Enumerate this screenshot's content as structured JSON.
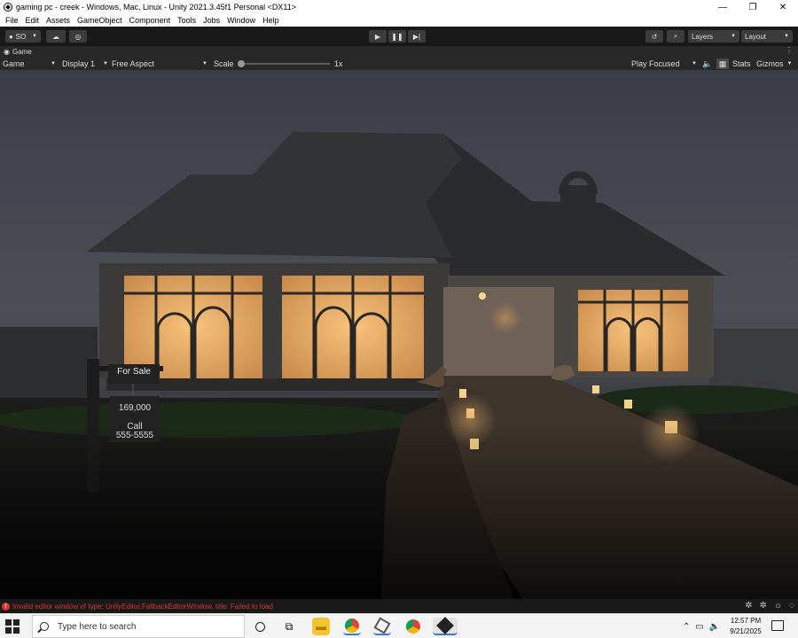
{
  "window": {
    "title": "gaming pc - creek - Windows, Mac, Linux - Unity 2021.3.45f1 Personal <DX11>",
    "minimize": "—",
    "restore": "❐",
    "close": "✕"
  },
  "menu": [
    "File",
    "Edit",
    "Assets",
    "GameObject",
    "Component",
    "Tools",
    "Jobs",
    "Window",
    "Help"
  ],
  "toolbar": {
    "account": "SO",
    "layers": "Layers",
    "layout": "Layout"
  },
  "tab": {
    "label": "Game"
  },
  "gamebar": {
    "mode": "Game",
    "display": "Display 1",
    "aspect": "Free Aspect",
    "scale_label": "Scale",
    "scale_value": "1x",
    "play_focused": "Play Focused",
    "stats": "Stats",
    "gizmos": "Gizmos"
  },
  "scene": {
    "sign_title": "For Sale",
    "sign_price": "169,000",
    "sign_call": "Call",
    "sign_phone": "555-5555"
  },
  "status": {
    "error": "Invalid editor window of type: UnityEditor.FallbackEditorWindow, title: Failed to load"
  },
  "taskbar": {
    "search_placeholder": "Type here to search",
    "time": "12:57 PM",
    "date": "9/21/2025"
  },
  "colors": {
    "error_text": "#dd3333",
    "editor_bg": "#282828",
    "window_light": "#f2b86a"
  }
}
